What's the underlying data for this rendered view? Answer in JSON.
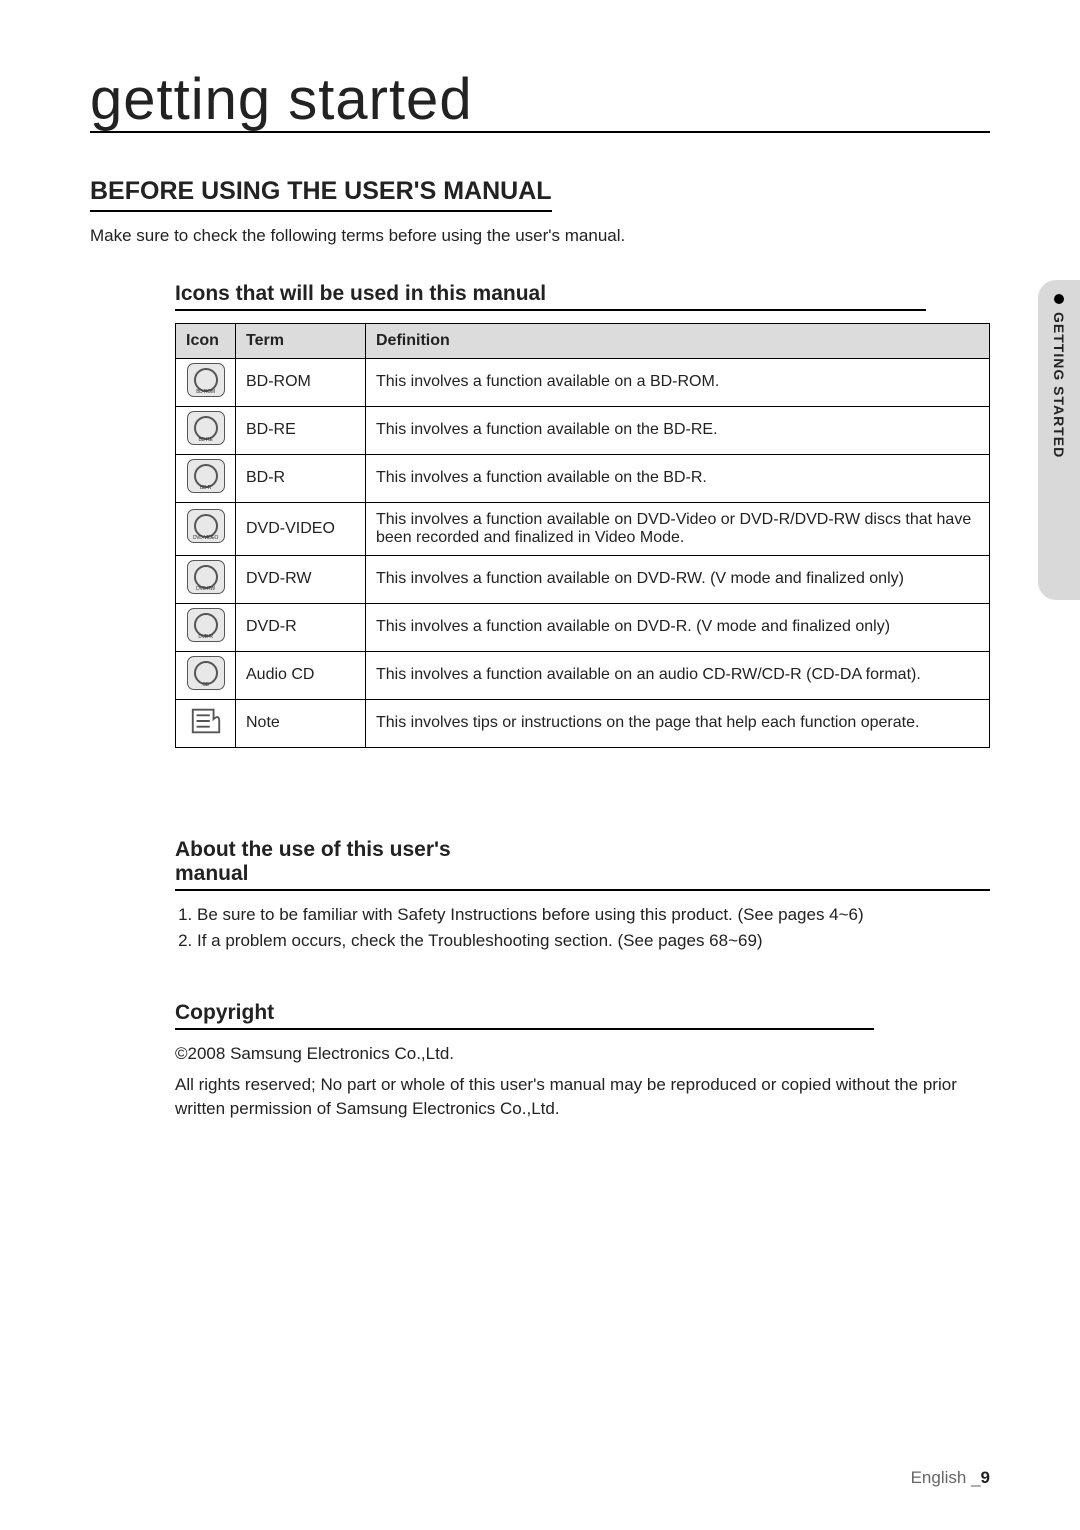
{
  "title": "getting started",
  "section1": {
    "heading": "BEFORE USING THE USER'S MANUAL",
    "intro": "Make sure to check the following terms before using the user's manual."
  },
  "icons_section": {
    "heading": "Icons that will be used in this manual",
    "headers": {
      "icon": "Icon",
      "term": "Term",
      "definition": "Definition"
    },
    "rows": [
      {
        "icon_label": "BD-ROM",
        "term": "BD-ROM",
        "definition": "This involves a function available on a BD-ROM."
      },
      {
        "icon_label": "BD-RE",
        "term": "BD-RE",
        "definition": "This involves a function available on the BD-RE."
      },
      {
        "icon_label": "BD-R",
        "term": "BD-R",
        "definition": "This involves a function available on the BD-R."
      },
      {
        "icon_label": "DVD-VIDEO",
        "term": "DVD-VIDEO",
        "definition": "This involves a function available on DVD-Video or DVD-R/DVD-RW discs that have been recorded and finalized in Video Mode."
      },
      {
        "icon_label": "DVD-RW",
        "term": "DVD-RW",
        "definition": "This involves a function available on DVD-RW. (V mode and finalized only)"
      },
      {
        "icon_label": "DVD-R",
        "term": "DVD-R",
        "definition": "This involves a function available on DVD-R. (V mode and finalized only)"
      },
      {
        "icon_label": "CD",
        "term": "Audio CD",
        "definition": "This involves a function available on an audio CD-RW/CD-R (CD-DA format)."
      },
      {
        "icon_label": "NOTE",
        "term": "Note",
        "definition": "This involves tips or instructions on the page that help each function operate."
      }
    ]
  },
  "about_section": {
    "heading": "About the use of this user's manual",
    "items": [
      "Be sure to be familiar with Safety Instructions before using this product. (See pages 4~6)",
      "If a problem occurs, check the Troubleshooting section. (See pages 68~69)"
    ]
  },
  "copyright_section": {
    "heading": "Copyright",
    "line1": "©2008 Samsung Electronics Co.,Ltd.",
    "line2": "All rights reserved; No part or whole of this user's manual may be reproduced or copied without the prior written permission of Samsung Electronics Co.,Ltd."
  },
  "side_tab": "GETTING STARTED",
  "footer": {
    "lang": "English _",
    "page": "9"
  }
}
